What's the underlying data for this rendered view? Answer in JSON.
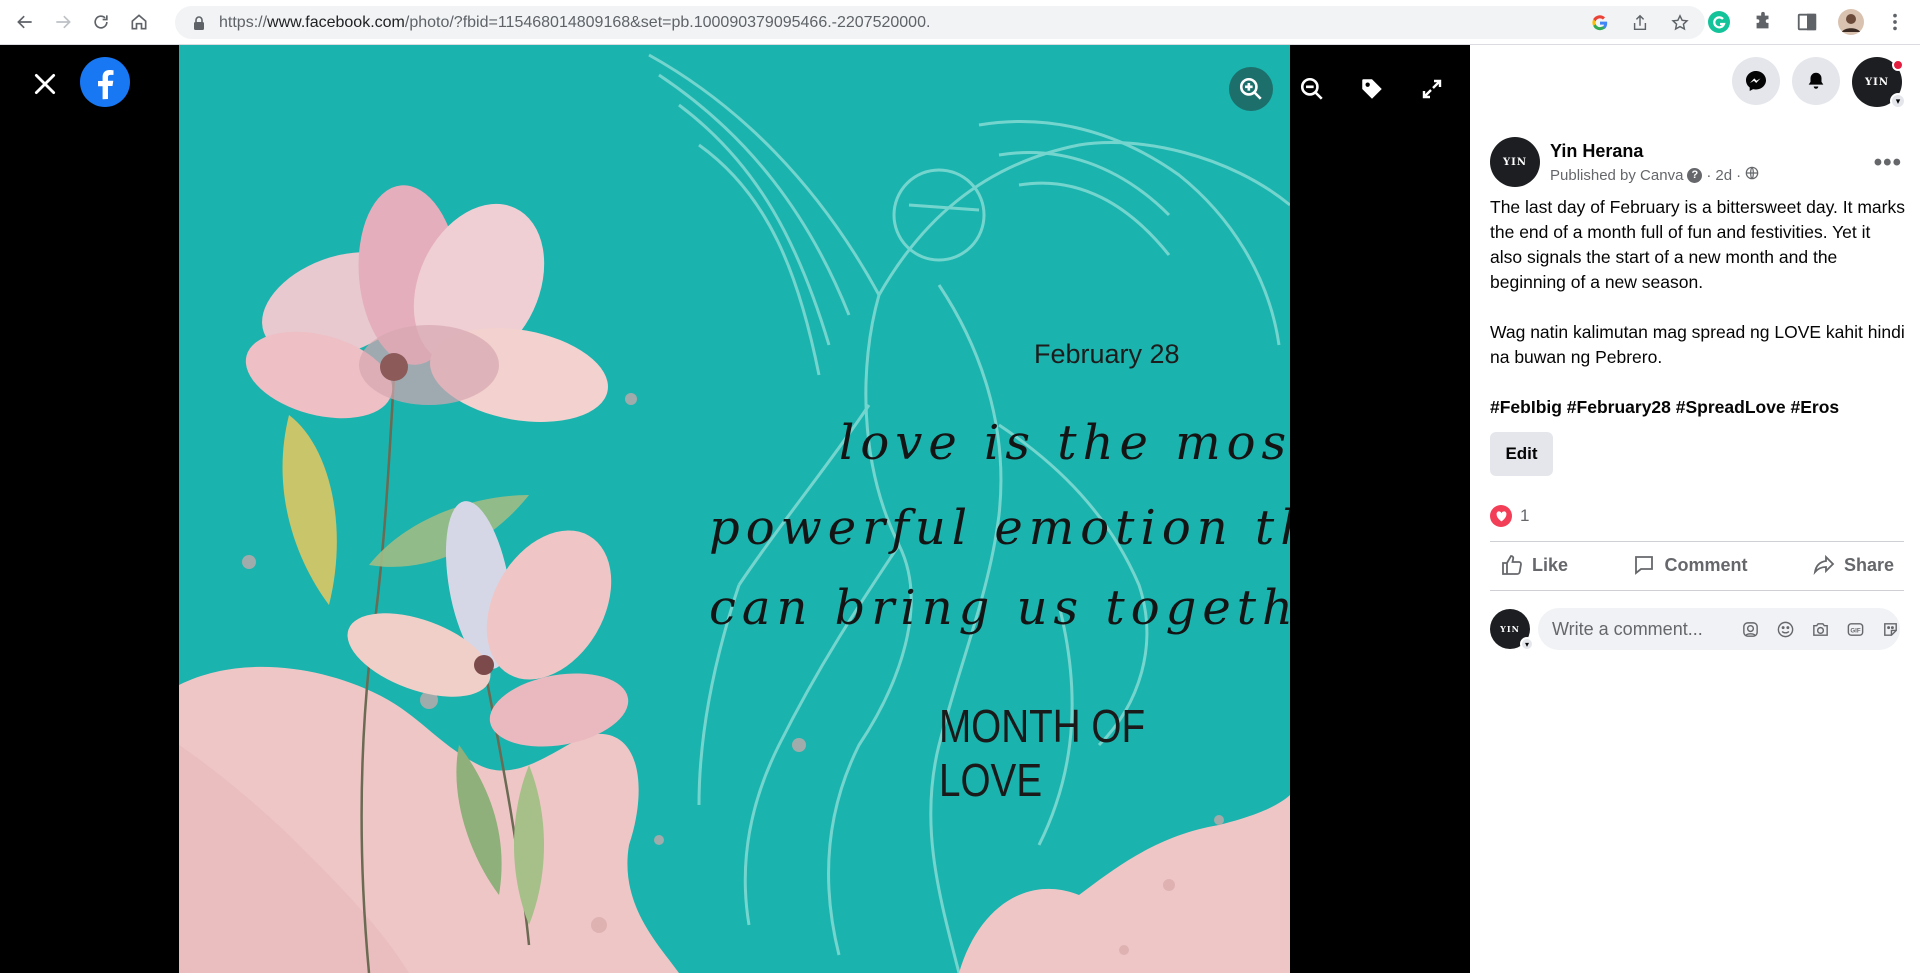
{
  "browser": {
    "url_prefix": "https://",
    "url_host": "www.facebook.com",
    "url_path": "/photo/?fbid=115468014809168&set=pb.100090379095466.-2207520000.",
    "icons": [
      "back-arrow-icon",
      "forward-arrow-icon",
      "reload-icon",
      "home-icon",
      "lock-icon",
      "google-icon",
      "share-icon",
      "star-icon",
      "grammarly-icon",
      "puzzle-icon",
      "sidepanel-icon",
      "profile-icon",
      "kebab-menu-icon"
    ]
  },
  "viewer": {
    "photo": {
      "date_text": "February 28",
      "quote_lines": [
        "love is the most",
        "powerful emotion that",
        "can bring us together"
      ],
      "footer_text": "MONTH OF LOVE",
      "colors": {
        "background": "#1bb3ad",
        "petal": "#efc6c6",
        "angel_outline": "#7ed9d3"
      }
    },
    "tools": [
      "zoom-in-icon",
      "zoom-out-icon",
      "tag-icon",
      "fullscreen-icon"
    ]
  },
  "panel": {
    "author": "Yin Herana",
    "published_by": "Published by Canva",
    "time": "2d",
    "post_paragraphs": [
      "The last day of February is a bittersweet day. It marks the end of a month full of fun and festivities. Yet it also signals the start of a new month and the beginning of a new season.",
      "Wag natin kalimutan mag spread ng LOVE kahit hindi na buwan ng Pebrero."
    ],
    "hashtags": "#FebIbig #February28 #SpreadLove #Eros",
    "edit_label": "Edit",
    "reaction_count": "1",
    "actions": {
      "like": "Like",
      "comment": "Comment",
      "share": "Share"
    },
    "comment_placeholder": "Write a comment...",
    "avatar_logo": "YIN"
  }
}
